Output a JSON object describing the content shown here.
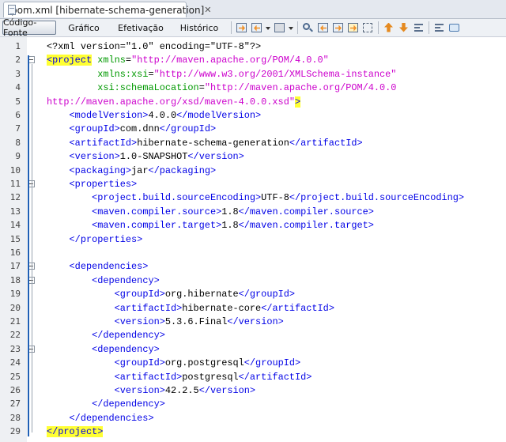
{
  "tab": {
    "title": "pom.xml [hibernate-schema-generation]",
    "close": "✕"
  },
  "toolbar": {
    "views": [
      "Código-Fonte",
      "Gráfico",
      "Efetivação",
      "Histórico"
    ],
    "icons": [
      "last-edit-icon",
      "back-icon",
      "dropdown-icon",
      "forward-icon",
      "dropdown-icon",
      "find-icon",
      "find-prev-icon",
      "find-next-icon",
      "toggle-highlight-icon",
      "select-icon",
      "prev-bookmark-icon",
      "next-bookmark-icon",
      "toggle-bookmark-icon",
      "shift-left-icon",
      "comment-icon"
    ]
  },
  "editor": {
    "lines": [
      {
        "n": "1",
        "parts": [
          {
            "t": "<?xml version=\"1.0\" encoding=\"UTF-8\"?>",
            "c": "txt"
          }
        ]
      },
      {
        "n": "2",
        "parts": [
          {
            "t": "<project",
            "c": "tag hl"
          },
          {
            "t": " ",
            "c": "txt"
          },
          {
            "t": "xmlns",
            "c": "attr"
          },
          {
            "t": "=",
            "c": "txt"
          },
          {
            "t": "\"http://maven.apache.org/POM/4.0.0\"",
            "c": "val"
          }
        ]
      },
      {
        "n": "3",
        "parts": [
          {
            "t": "         ",
            "c": "txt"
          },
          {
            "t": "xmlns:xsi",
            "c": "attr"
          },
          {
            "t": "=",
            "c": "txt"
          },
          {
            "t": "\"http://www.w3.org/2001/XMLSchema-instance\"",
            "c": "val"
          }
        ]
      },
      {
        "n": "4",
        "parts": [
          {
            "t": "         ",
            "c": "txt"
          },
          {
            "t": "xsi:schemaLocation",
            "c": "attr"
          },
          {
            "t": "=",
            "c": "txt"
          },
          {
            "t": "\"http://maven.apache.org/POM/4.0.0",
            "c": "val"
          }
        ]
      },
      {
        "n": "5",
        "parts": [
          {
            "t": "http://maven.apache.org/xsd/maven-4.0.0.xsd\"",
            "c": "val"
          },
          {
            "t": ">",
            "c": "tag hl"
          }
        ]
      },
      {
        "n": "6",
        "parts": [
          {
            "t": "    ",
            "c": "txt"
          },
          {
            "t": "<modelVersion>",
            "c": "tag"
          },
          {
            "t": "4.0.0",
            "c": "txt"
          },
          {
            "t": "</modelVersion>",
            "c": "tag"
          }
        ]
      },
      {
        "n": "7",
        "parts": [
          {
            "t": "    ",
            "c": "txt"
          },
          {
            "t": "<groupId>",
            "c": "tag"
          },
          {
            "t": "com.dnn",
            "c": "txt"
          },
          {
            "t": "</groupId>",
            "c": "tag"
          }
        ]
      },
      {
        "n": "8",
        "parts": [
          {
            "t": "    ",
            "c": "txt"
          },
          {
            "t": "<artifactId>",
            "c": "tag"
          },
          {
            "t": "hibernate-schema-generation",
            "c": "txt"
          },
          {
            "t": "</artifactId>",
            "c": "tag"
          }
        ]
      },
      {
        "n": "9",
        "parts": [
          {
            "t": "    ",
            "c": "txt"
          },
          {
            "t": "<version>",
            "c": "tag"
          },
          {
            "t": "1.0-SNAPSHOT",
            "c": "txt"
          },
          {
            "t": "</version>",
            "c": "tag"
          }
        ]
      },
      {
        "n": "10",
        "parts": [
          {
            "t": "    ",
            "c": "txt"
          },
          {
            "t": "<packaging>",
            "c": "tag"
          },
          {
            "t": "jar",
            "c": "txt"
          },
          {
            "t": "</packaging>",
            "c": "tag"
          }
        ]
      },
      {
        "n": "11",
        "parts": [
          {
            "t": "    ",
            "c": "txt"
          },
          {
            "t": "<properties>",
            "c": "tag"
          }
        ]
      },
      {
        "n": "12",
        "parts": [
          {
            "t": "        ",
            "c": "txt"
          },
          {
            "t": "<project.build.sourceEncoding>",
            "c": "tag"
          },
          {
            "t": "UTF-8",
            "c": "txt"
          },
          {
            "t": "</project.build.sourceEncoding>",
            "c": "tag"
          }
        ]
      },
      {
        "n": "13",
        "parts": [
          {
            "t": "        ",
            "c": "txt"
          },
          {
            "t": "<maven.compiler.source>",
            "c": "tag"
          },
          {
            "t": "1.8",
            "c": "txt"
          },
          {
            "t": "</maven.compiler.source>",
            "c": "tag"
          }
        ]
      },
      {
        "n": "14",
        "parts": [
          {
            "t": "        ",
            "c": "txt"
          },
          {
            "t": "<maven.compiler.target>",
            "c": "tag"
          },
          {
            "t": "1.8",
            "c": "txt"
          },
          {
            "t": "</maven.compiler.target>",
            "c": "tag"
          }
        ]
      },
      {
        "n": "15",
        "parts": [
          {
            "t": "    ",
            "c": "txt"
          },
          {
            "t": "</properties>",
            "c": "tag"
          }
        ]
      },
      {
        "n": "16",
        "parts": [
          {
            "t": "",
            "c": "txt"
          }
        ]
      },
      {
        "n": "17",
        "parts": [
          {
            "t": "    ",
            "c": "txt"
          },
          {
            "t": "<dependencies>",
            "c": "tag"
          }
        ]
      },
      {
        "n": "18",
        "parts": [
          {
            "t": "        ",
            "c": "txt"
          },
          {
            "t": "<dependency>",
            "c": "tag"
          }
        ]
      },
      {
        "n": "19",
        "parts": [
          {
            "t": "            ",
            "c": "txt"
          },
          {
            "t": "<groupId>",
            "c": "tag"
          },
          {
            "t": "org.hibernate",
            "c": "txt"
          },
          {
            "t": "</groupId>",
            "c": "tag"
          }
        ]
      },
      {
        "n": "20",
        "parts": [
          {
            "t": "            ",
            "c": "txt"
          },
          {
            "t": "<artifactId>",
            "c": "tag"
          },
          {
            "t": "hibernate-core",
            "c": "txt"
          },
          {
            "t": "</artifactId>",
            "c": "tag"
          }
        ]
      },
      {
        "n": "21",
        "parts": [
          {
            "t": "            ",
            "c": "txt"
          },
          {
            "t": "<version>",
            "c": "tag"
          },
          {
            "t": "5.3.6.Final",
            "c": "txt"
          },
          {
            "t": "</version>",
            "c": "tag"
          }
        ]
      },
      {
        "n": "22",
        "parts": [
          {
            "t": "        ",
            "c": "txt"
          },
          {
            "t": "</dependency>",
            "c": "tag"
          }
        ]
      },
      {
        "n": "23",
        "parts": [
          {
            "t": "        ",
            "c": "txt"
          },
          {
            "t": "<dependency>",
            "c": "tag"
          }
        ]
      },
      {
        "n": "24",
        "parts": [
          {
            "t": "            ",
            "c": "txt"
          },
          {
            "t": "<groupId>",
            "c": "tag"
          },
          {
            "t": "org.postgresql",
            "c": "txt"
          },
          {
            "t": "</groupId>",
            "c": "tag"
          }
        ]
      },
      {
        "n": "25",
        "parts": [
          {
            "t": "            ",
            "c": "txt"
          },
          {
            "t": "<artifactId>",
            "c": "tag"
          },
          {
            "t": "postgresql",
            "c": "txt"
          },
          {
            "t": "</artifactId>",
            "c": "tag"
          }
        ]
      },
      {
        "n": "26",
        "parts": [
          {
            "t": "            ",
            "c": "txt"
          },
          {
            "t": "<version>",
            "c": "tag"
          },
          {
            "t": "42.2.5",
            "c": "txt"
          },
          {
            "t": "</version>",
            "c": "tag"
          }
        ]
      },
      {
        "n": "27",
        "parts": [
          {
            "t": "        ",
            "c": "txt"
          },
          {
            "t": "</dependency>",
            "c": "tag"
          }
        ]
      },
      {
        "n": "28",
        "parts": [
          {
            "t": "    ",
            "c": "txt"
          },
          {
            "t": "</dependencies>",
            "c": "tag"
          }
        ]
      },
      {
        "n": "29",
        "parts": [
          {
            "t": "</project>",
            "c": "tag hl"
          }
        ]
      }
    ]
  }
}
